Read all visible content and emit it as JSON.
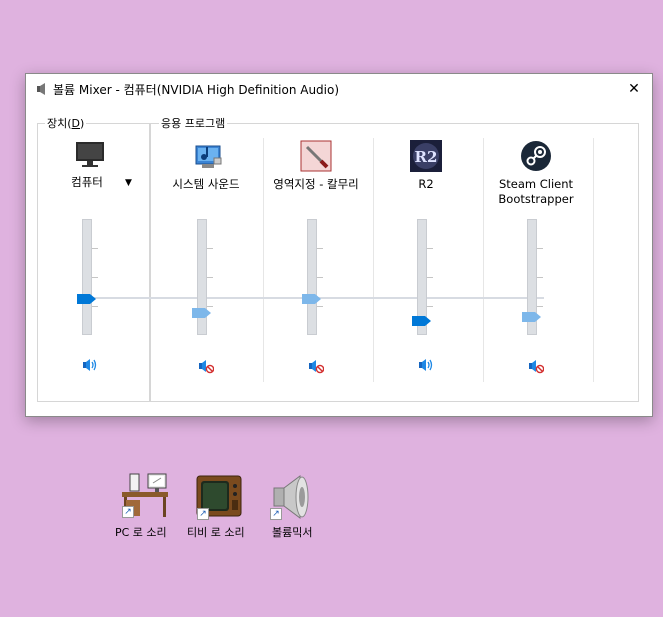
{
  "window": {
    "title": "볼륨 Mixer - 컴퓨터(NVIDIA High Definition Audio)",
    "close_label": "✕"
  },
  "device_group": {
    "label_prefix": "장치(",
    "label_accel": "D",
    "label_suffix": ")",
    "device": {
      "name": "컴퓨터",
      "icon": "monitor-icon",
      "volume": 0.5,
      "muted": false
    }
  },
  "apps_group": {
    "label": "응용 프로그램",
    "apps": [
      {
        "name": "시스템 사운드",
        "icon": "system-sounds-icon",
        "volume": 0.4,
        "muted": true
      },
      {
        "name": "영역지정 - 칼무리",
        "icon": "knife-tool-icon",
        "volume": 0.5,
        "muted": true
      },
      {
        "name": "R2",
        "icon": "r2-game-icon",
        "volume": 0.2,
        "muted": false
      },
      {
        "name": "Steam Client\nBootstrapper",
        "icon": "steam-icon",
        "volume": 0.3,
        "muted": true
      }
    ]
  },
  "desktop_icons": [
    {
      "label": "PC 로 소리",
      "icon": "pc-desk-icon"
    },
    {
      "label": "티비 로 소리",
      "icon": "tv-icon"
    },
    {
      "label": "볼륨믹서",
      "icon": "speaker-icon"
    }
  ],
  "colors": {
    "accent": "#0078d7",
    "thumb_muted": "#7db7ea",
    "background": "#dfb2df"
  }
}
